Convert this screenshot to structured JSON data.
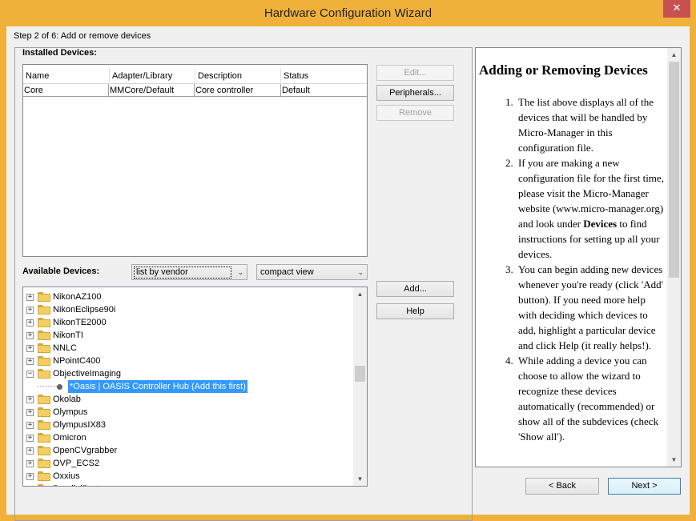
{
  "window": {
    "title": "Hardware Configuration Wizard",
    "close_glyph": "✕"
  },
  "step_label": "Step 2 of 6: Add or remove devices",
  "installed": {
    "label": "Installed Devices:",
    "columns": [
      "Name",
      "Adapter/Library",
      "Description",
      "Status"
    ],
    "rows": [
      [
        "Core",
        "MMCore/Default",
        "Core controller",
        "Default"
      ]
    ]
  },
  "buttons": {
    "edit": "Edit...",
    "peripherals": "Peripherals...",
    "remove": "Remove",
    "add": "Add...",
    "help": "Help",
    "back": "< Back",
    "next": "Next >"
  },
  "available": {
    "label": "Available Devices:",
    "sort_combo": "list by vendor",
    "view_combo": "compact view",
    "tree": [
      {
        "label": "NikonAZ100",
        "expanded": false
      },
      {
        "label": "NikonEclipse90i",
        "expanded": false
      },
      {
        "label": "NikonTE2000",
        "expanded": false
      },
      {
        "label": "NikonTI",
        "expanded": false
      },
      {
        "label": "NNLC",
        "expanded": false
      },
      {
        "label": "NPointC400",
        "expanded": false
      },
      {
        "label": "ObjectiveImaging",
        "expanded": true
      },
      {
        "label": "*Oasis | OASIS Controller Hub (Add this first)",
        "leaf": true,
        "selected": true
      },
      {
        "label": "Okolab",
        "expanded": false
      },
      {
        "label": "Olympus",
        "expanded": false
      },
      {
        "label": "OlympusIX83",
        "expanded": false
      },
      {
        "label": "Omicron",
        "expanded": false
      },
      {
        "label": "OpenCVgrabber",
        "expanded": false
      },
      {
        "label": "OVP_ECS2",
        "expanded": false
      },
      {
        "label": "Oxxius",
        "expanded": false
      },
      {
        "label": "ParallelPort",
        "expanded": false
      }
    ]
  },
  "help": {
    "title": "Adding or Removing Devices",
    "items": [
      {
        "num": "1.",
        "text": "The list above displays all of the devices that will be handled by Micro-Manager in this configuration file."
      },
      {
        "num": "2.",
        "pre": "If you are making a new configuration file for the first time, please visit the Micro-Manager website (www.micro-manager.org) and look under ",
        "bold": "Devices",
        "post": " to find instructions for setting up all your devices."
      },
      {
        "num": "3.",
        "text": "You can begin adding new devices whenever you're ready (click 'Add' button). If you need more help with deciding which devices to add, highlight a particular device and click Help (it really helps!)."
      },
      {
        "num": "4.",
        "text": "While adding a device you can choose to allow the wizard to recognize these devices automatically (recommended) or show all of the subdevices (check 'Show all')."
      }
    ]
  },
  "icons": {
    "expand_collapsed": "+",
    "expand_expanded": "−",
    "scroll_up": "▲",
    "scroll_down": "▼",
    "combo_arrow": "⌄"
  },
  "colors": {
    "titlebar": "#f0b13b",
    "selection": "#3399ff",
    "close_button": "#c75050"
  }
}
